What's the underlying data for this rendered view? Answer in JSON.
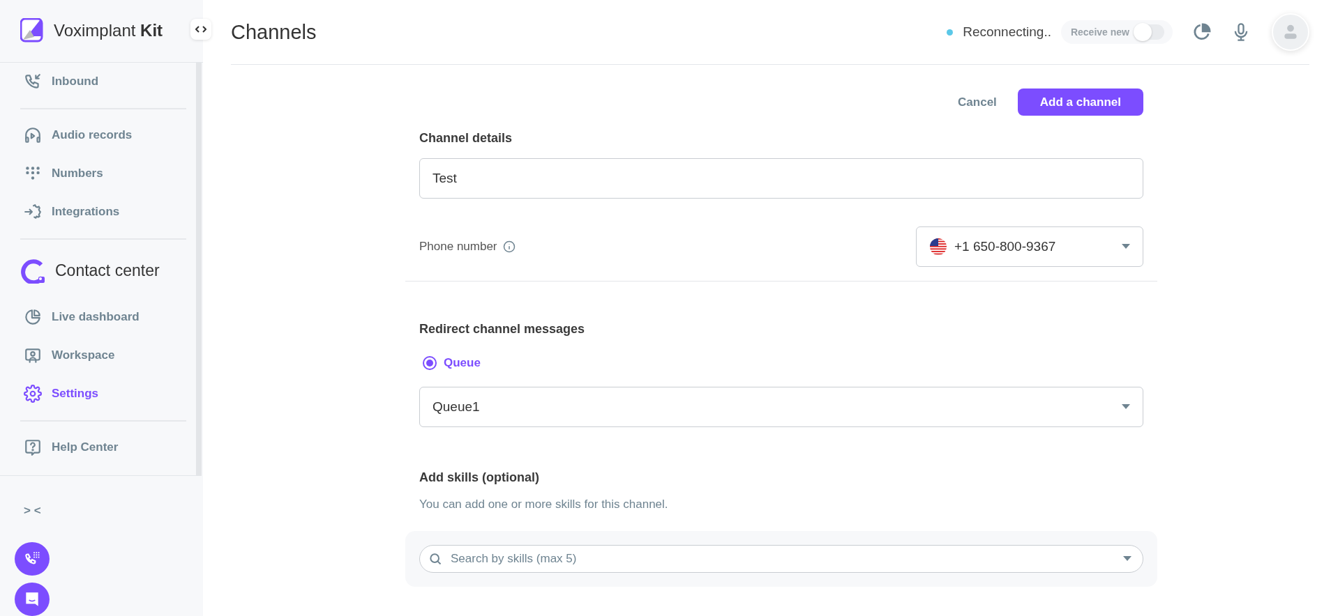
{
  "brand": {
    "name": "Voximplant",
    "suffix": "Kit"
  },
  "sidebar": {
    "items": [
      {
        "kind": "item",
        "label": "Inbound",
        "selected": false
      },
      {
        "kind": "divider"
      },
      {
        "kind": "item",
        "label": "Audio records",
        "selected": false
      },
      {
        "kind": "item",
        "label": "Numbers",
        "selected": false
      },
      {
        "kind": "item",
        "label": "Integrations",
        "selected": false
      },
      {
        "kind": "divider"
      },
      {
        "kind": "section",
        "label": "Contact center"
      },
      {
        "kind": "item",
        "label": "Live dashboard",
        "selected": false
      },
      {
        "kind": "item",
        "label": "Workspace",
        "selected": false
      },
      {
        "kind": "item",
        "label": "Settings",
        "selected": true
      },
      {
        "kind": "divider"
      },
      {
        "kind": "item",
        "label": "Help Center",
        "selected": false
      }
    ],
    "collapse": "> <"
  },
  "header": {
    "title": "Channels",
    "status": {
      "text": "Reconnecting..",
      "color": "#5bc8e8"
    },
    "receive": {
      "label": "Receive new",
      "on": false,
      "disabled": true
    }
  },
  "actions": {
    "cancel": "Cancel",
    "primary": "Add a channel"
  },
  "form": {
    "details_heading": "Channel details",
    "name_value": "Test",
    "phone": {
      "label": "Phone number",
      "value": "+1 650-800-9367"
    },
    "redirect": {
      "heading": "Redirect channel messages",
      "options": [
        {
          "label": "Queue",
          "selected": true
        }
      ],
      "queue_value": "Queue1"
    },
    "skills": {
      "heading": "Add skills (optional)",
      "hint": "You can add one or more skills for this channel.",
      "placeholder": "Search by skills (max 5)"
    }
  }
}
